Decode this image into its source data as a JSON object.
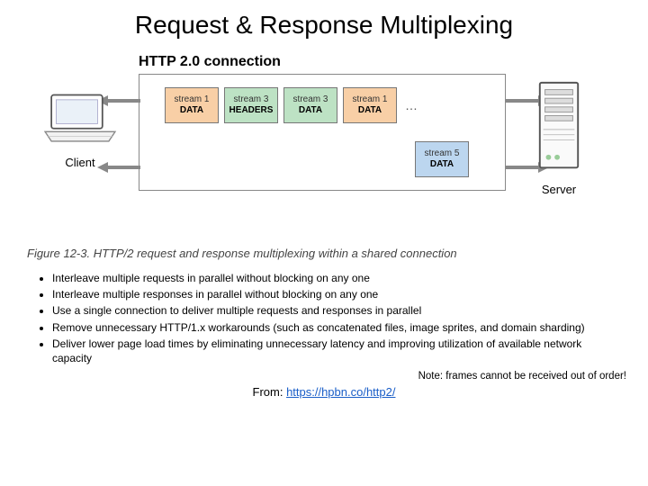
{
  "title": "Request & Response Multiplexing",
  "connection_title": "HTTP 2.0 connection",
  "client_label": "Client",
  "server_label": "Server",
  "top_row": [
    {
      "line1": "stream 1",
      "line2": "DATA",
      "color": "orange"
    },
    {
      "line1": "stream 3",
      "line2": "HEADERS",
      "color": "green"
    },
    {
      "line1": "stream 3",
      "line2": "DATA",
      "color": "green"
    },
    {
      "line1": "stream 1",
      "line2": "DATA",
      "color": "orange"
    }
  ],
  "ellipsis": "…",
  "bottom_row": [
    {
      "line1": "stream 5",
      "line2": "DATA",
      "color": "blue"
    }
  ],
  "caption": "Figure 12-3. HTTP/2 request and response multiplexing within a shared connection",
  "bullets": [
    "Interleave multiple requests in parallel without blocking on any one",
    "Interleave multiple responses in parallel without blocking on any one",
    "Use a single connection to deliver multiple requests and responses in parallel",
    "Remove unnecessary HTTP/1.x workarounds (such as concatenated files, image sprites, and domain sharding)",
    "Deliver lower page load times by eliminating unnecessary latency and improving utilization of available network capacity"
  ],
  "note": "Note: frames cannot be received out of order!",
  "source_prefix": "From: ",
  "source_url_text": "https://hpbn.co/http2/",
  "source_url": "https://hpbn.co/http2/"
}
